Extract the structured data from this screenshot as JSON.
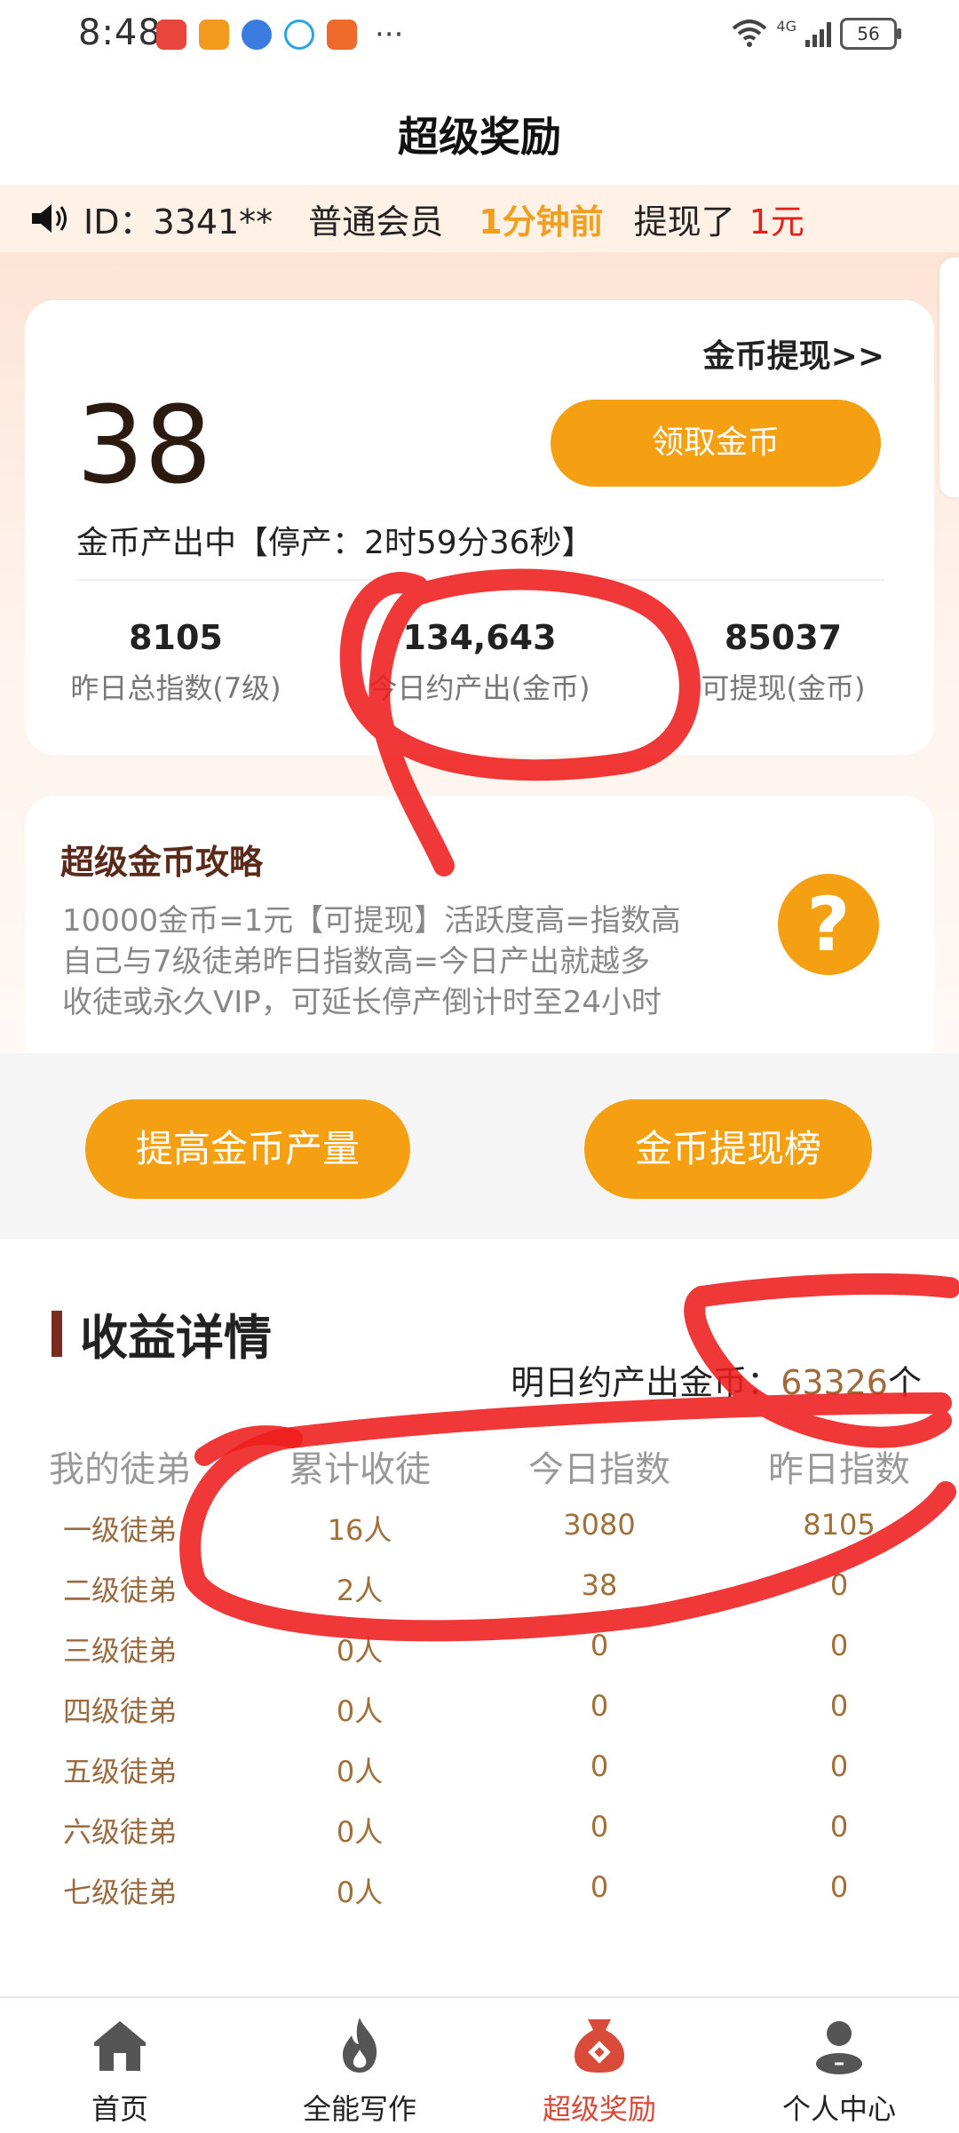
{
  "status_bar": {
    "time": "8:48",
    "network": "4G",
    "battery": "56",
    "app_icons": [
      "app-icon-red",
      "app-icon-orange-play",
      "app-icon-blue-globe",
      "app-icon-chat",
      "app-icon-orange-grid"
    ],
    "more": "···"
  },
  "header": {
    "title": "超级奖励"
  },
  "ticker": {
    "id": "ID：3341**",
    "member": "普通会员",
    "time_ago": "1分钟前",
    "action": "提现了",
    "amount": "1元"
  },
  "coin_card": {
    "withdraw_link": "金币提现>>",
    "coins": "38",
    "claim_button": "领取金币",
    "producing_text": "金币产出中【停产：2时59分36秒】",
    "stats": [
      {
        "value": "8105",
        "label": "昨日总指数(7级)"
      },
      {
        "value": "134,643",
        "label": "今日约产出(金币)"
      },
      {
        "value": "85037",
        "label": "可提现(金币)"
      }
    ]
  },
  "strategy_card": {
    "title": "超级金币攻略",
    "lines": [
      "10000金币=1元【可提现】活跃度高=指数高",
      "自己与7级徒弟昨日指数高=今日产出就越多",
      "收徒或永久VIP，可延长停产倒计时至24小时"
    ],
    "help_icon": "?"
  },
  "actions": {
    "increase_button": "提高金币产量",
    "leaderboard_button": "金币提现榜"
  },
  "earnings": {
    "title": "收益详情",
    "tomorrow_label": "明日约产出金币：",
    "tomorrow_value": "63326",
    "tomorrow_unit": "个",
    "columns": [
      "我的徒弟",
      "累计收徒",
      "今日指数",
      "昨日指数"
    ],
    "rows": [
      [
        "一级徒弟",
        "16人",
        "3080",
        "8105"
      ],
      [
        "二级徒弟",
        "2人",
        "38",
        "0"
      ],
      [
        "三级徒弟",
        "0人",
        "0",
        "0"
      ],
      [
        "四级徒弟",
        "0人",
        "0",
        "0"
      ],
      [
        "五级徒弟",
        "0人",
        "0",
        "0"
      ],
      [
        "六级徒弟",
        "0人",
        "0",
        "0"
      ],
      [
        "七级徒弟",
        "0人",
        "0",
        "0"
      ]
    ]
  },
  "bottom_nav": {
    "items": [
      {
        "label": "首页",
        "icon": "home-icon"
      },
      {
        "label": "全能写作",
        "icon": "flame-icon"
      },
      {
        "label": "超级奖励",
        "icon": "money-bag-icon"
      },
      {
        "label": "个人中心",
        "icon": "person-icon"
      }
    ],
    "active_index": 2,
    "active_color": "#d84a3a"
  },
  "colors": {
    "accent_orange": "#f5a013",
    "annotation_red": "#ee1c1c",
    "ticker_highlight": "#f0a020",
    "ticker_amount": "#e0201a"
  }
}
